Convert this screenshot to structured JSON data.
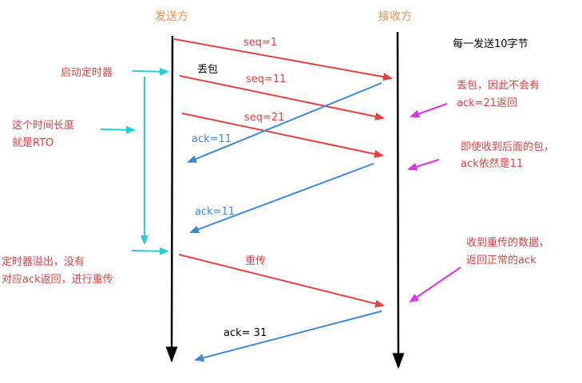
{
  "sender_label": "发送方",
  "receiver_label": "接收方",
  "note_bytes": "每一发送10字节",
  "packets": {
    "seq1": "seq=1",
    "seq11": "seq=11",
    "seq21": "seq=21",
    "lost": "丢包",
    "ack11_a": "ack=11",
    "ack11_b": "ack=11",
    "retransmit": "重传",
    "ack31": "ack= 31"
  },
  "left_notes": {
    "start_timer": "启动定时器",
    "rto_line1": "这个时间长度",
    "rto_line2": "就是RTO",
    "timeout_line1": "定时器溢出，没有",
    "timeout_line2": "对应ack返回，进行重传"
  },
  "right_notes": {
    "lost_line1": "丢包，因此不会有",
    "lost_line2": "ack=21返回",
    "later_line1": "即使收到后面的包，",
    "later_line2": "ack依然是11",
    "retrans_line1": "收到重传的数据，",
    "retrans_line2": "返回正常的ack"
  },
  "colors": {
    "data": "#e8403f",
    "ack": "#3a8ad8",
    "timer": "#22d0d8",
    "note_pointer": "#e030e8",
    "label": "#e8914a"
  }
}
